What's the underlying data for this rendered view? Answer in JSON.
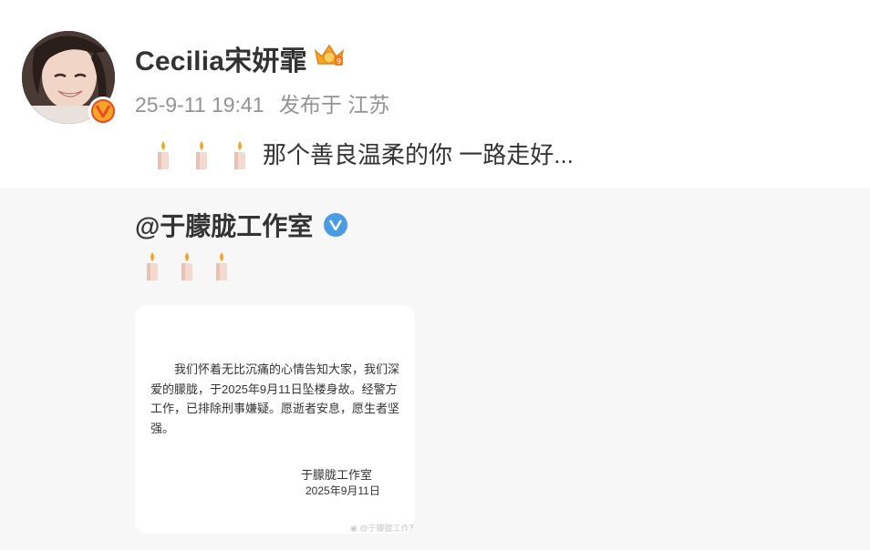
{
  "post": {
    "username": "Cecilia宋妍霏",
    "timestamp": "25-9-11 19:41",
    "location": "发布于 江苏",
    "text": "那个善良温柔的你 一路走好...",
    "emoji": "candle-emoji"
  },
  "repost": {
    "username": "@于朦胧工作室",
    "emoji": "candle-emoji",
    "image": {
      "body": "我们怀着无比沉痛的心情告知大家，我们深爱的朦胧，于2025年9月11日坠楼身故。经警方工作，已排除刑事嫌疑。愿逝者安息，愿生者坚强。",
      "signature": "于朦胧工作室",
      "date": "2025年9月11日",
      "watermark": "@于朦胧工作室"
    }
  },
  "colors": {
    "text": "#333333",
    "meta": "#939393",
    "repost_bg": "#f7f7f7",
    "verified_blue": "#4a9de5",
    "verified_orange": "#f5a623"
  }
}
